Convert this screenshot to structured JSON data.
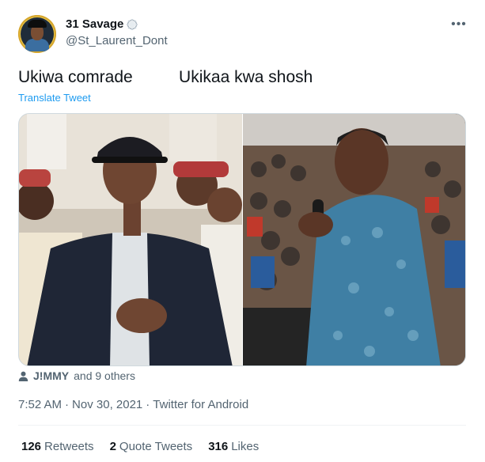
{
  "author": {
    "display_name": "31 Savage",
    "handle": "@St_Laurent_Dont",
    "verified_badge_icon": "scalloped-badge-icon"
  },
  "menu": {
    "more_icon": "more-horizontal-icon",
    "more_label": "•••"
  },
  "tweet": {
    "text": "Ukiwa comrade          Ukikaa kwa shosh",
    "translate_label": "Translate Tweet"
  },
  "media": {
    "photos": [
      {
        "icon": "photo-young-man-in-cap-at-rally"
      },
      {
        "icon": "photo-man-in-paisley-shirt-with-microphone"
      }
    ]
  },
  "tagged": {
    "icon": "person-icon",
    "name": "J!MMY",
    "others": "and 9 others"
  },
  "meta": {
    "time": "7:52 AM",
    "separator1": "·",
    "date": "Nov 30, 2021",
    "separator2": "·",
    "source": "Twitter for Android"
  },
  "stats": [
    {
      "count": "126",
      "label": "Retweets"
    },
    {
      "count": "2",
      "label": "Quote Tweets"
    },
    {
      "count": "316",
      "label": "Likes"
    }
  ],
  "colors": {
    "link": "#1d9bf0",
    "secondary_text": "#536471",
    "primary_text": "#0f1419",
    "divider": "#eff3f4"
  }
}
